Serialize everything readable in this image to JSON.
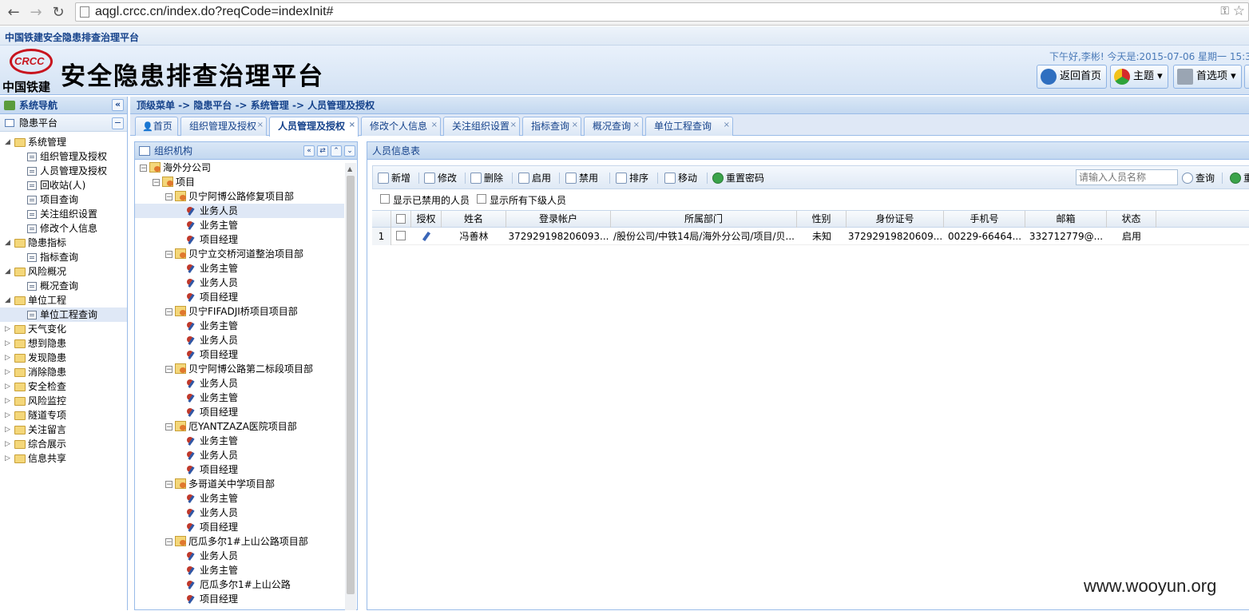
{
  "browser": {
    "url": "aqgl.crcc.cn/index.do?reqCode=indexInit#"
  },
  "app": {
    "strip_title": "中国铁建安全隐患排查治理平台",
    "logo_mark": "CRCC",
    "logo_text": "中国铁建",
    "title": "安全隐患排查治理平台",
    "greeting": "下午好,李彬!  今天是:2015-07-06 星期一 15:3",
    "buttons": {
      "home": "返回首页",
      "theme": "主题",
      "prefs": "首选项"
    }
  },
  "nav": {
    "title": "系统导航",
    "section": "隐患平台",
    "tree": [
      {
        "label": "系统管理",
        "level": 0,
        "type": "folder",
        "open": true
      },
      {
        "label": "组织管理及授权",
        "level": 1,
        "type": "leaf"
      },
      {
        "label": "人员管理及授权",
        "level": 1,
        "type": "leaf"
      },
      {
        "label": "回收站(人)",
        "level": 1,
        "type": "leaf"
      },
      {
        "label": "项目查询",
        "level": 1,
        "type": "leaf"
      },
      {
        "label": "关注组织设置",
        "level": 1,
        "type": "leaf"
      },
      {
        "label": "修改个人信息",
        "level": 1,
        "type": "leaf"
      },
      {
        "label": "隐患指标",
        "level": 0,
        "type": "folder",
        "open": true
      },
      {
        "label": "指标查询",
        "level": 1,
        "type": "leaf"
      },
      {
        "label": "风险概况",
        "level": 0,
        "type": "folder",
        "open": true
      },
      {
        "label": "概况查询",
        "level": 1,
        "type": "leaf"
      },
      {
        "label": "单位工程",
        "level": 0,
        "type": "folder",
        "open": true
      },
      {
        "label": "单位工程查询",
        "level": 1,
        "type": "leaf",
        "selected": true
      },
      {
        "label": "天气变化",
        "level": 0,
        "type": "folder"
      },
      {
        "label": "想到隐患",
        "level": 0,
        "type": "folder"
      },
      {
        "label": "发现隐患",
        "level": 0,
        "type": "folder"
      },
      {
        "label": "消除隐患",
        "level": 0,
        "type": "folder"
      },
      {
        "label": "安全检查",
        "level": 0,
        "type": "folder"
      },
      {
        "label": "风险监控",
        "level": 0,
        "type": "folder"
      },
      {
        "label": "隧道专项",
        "level": 0,
        "type": "folder"
      },
      {
        "label": "关注留言",
        "level": 0,
        "type": "folder"
      },
      {
        "label": "综合展示",
        "level": 0,
        "type": "folder"
      },
      {
        "label": "信息共享",
        "level": 0,
        "type": "folder"
      }
    ]
  },
  "breadcrumb": "顶级菜单 -> 隐患平台 -> 系统管理 -> 人员管理及授权",
  "tabs": [
    {
      "label": "首页",
      "closable": false
    },
    {
      "label": "组织管理及授权",
      "closable": true
    },
    {
      "label": "人员管理及授权",
      "closable": true,
      "active": true
    },
    {
      "label": "修改个人信息",
      "closable": true
    },
    {
      "label": "关注组织设置",
      "closable": true
    },
    {
      "label": "指标查询",
      "closable": true
    },
    {
      "label": "概况查询",
      "closable": true
    },
    {
      "label": "单位工程查询",
      "closable": true
    }
  ],
  "org": {
    "title": "组织机构",
    "tree": [
      {
        "label": "海外分公司",
        "level": 0,
        "type": "root"
      },
      {
        "label": "项目",
        "level": 1,
        "type": "dept"
      },
      {
        "label": "贝宁阿博公路修复项目部",
        "level": 2,
        "type": "dept"
      },
      {
        "label": "业务人员",
        "level": 3,
        "type": "role",
        "selected": true
      },
      {
        "label": "业务主管",
        "level": 3,
        "type": "role"
      },
      {
        "label": "项目经理",
        "level": 3,
        "type": "role"
      },
      {
        "label": "贝宁立交桥河道整治项目部",
        "level": 2,
        "type": "dept"
      },
      {
        "label": "业务主管",
        "level": 3,
        "type": "role"
      },
      {
        "label": "业务人员",
        "level": 3,
        "type": "role"
      },
      {
        "label": "项目经理",
        "level": 3,
        "type": "role"
      },
      {
        "label": "贝宁FIFADJI桥项目项目部",
        "level": 2,
        "type": "dept"
      },
      {
        "label": "业务主管",
        "level": 3,
        "type": "role"
      },
      {
        "label": "业务人员",
        "level": 3,
        "type": "role"
      },
      {
        "label": "项目经理",
        "level": 3,
        "type": "role"
      },
      {
        "label": "贝宁阿博公路第二标段项目部",
        "level": 2,
        "type": "dept"
      },
      {
        "label": "业务人员",
        "level": 3,
        "type": "role"
      },
      {
        "label": "业务主管",
        "level": 3,
        "type": "role"
      },
      {
        "label": "项目经理",
        "level": 3,
        "type": "role"
      },
      {
        "label": "厄YANTZAZA医院项目部",
        "level": 2,
        "type": "dept"
      },
      {
        "label": "业务主管",
        "level": 3,
        "type": "role"
      },
      {
        "label": "业务人员",
        "level": 3,
        "type": "role"
      },
      {
        "label": "项目经理",
        "level": 3,
        "type": "role"
      },
      {
        "label": "多哥道关中学项目部",
        "level": 2,
        "type": "dept"
      },
      {
        "label": "业务主管",
        "level": 3,
        "type": "role"
      },
      {
        "label": "业务人员",
        "level": 3,
        "type": "role"
      },
      {
        "label": "项目经理",
        "level": 3,
        "type": "role"
      },
      {
        "label": "厄瓜多尔1#上山公路项目部",
        "level": 2,
        "type": "dept"
      },
      {
        "label": "业务人员",
        "level": 3,
        "type": "role"
      },
      {
        "label": "业务主管",
        "level": 3,
        "type": "role"
      },
      {
        "label": "厄瓜多尔1#上山公路",
        "level": 3,
        "type": "role"
      },
      {
        "label": "项目经理",
        "level": 3,
        "type": "role"
      }
    ]
  },
  "person": {
    "title": "人员信息表",
    "toolbar": [
      "新增",
      "修改",
      "删除",
      "启用",
      "禁用",
      "排序",
      "移动",
      "重置密码"
    ],
    "search_placeholder": "请输入人员名称",
    "search_button": "查询",
    "reset_button": "重",
    "filters": [
      "显示已禁用的人员",
      "显示所有下级人员"
    ],
    "columns": [
      "授权",
      "姓名",
      "登录帐户",
      "所属部门",
      "性别",
      "身份证号",
      "手机号",
      "邮箱",
      "状态"
    ],
    "rows": [
      {
        "index": "1",
        "name": "冯善林",
        "account": "372929198206093...",
        "dept": "/股份公司/中铁14局/海外分公司/项目/贝...",
        "gender": "未知",
        "id_no": "37292919820609...",
        "phone": "00229-66464...",
        "email": "332712779@...",
        "status": "启用"
      }
    ]
  },
  "watermark": "www.wooyun.org"
}
